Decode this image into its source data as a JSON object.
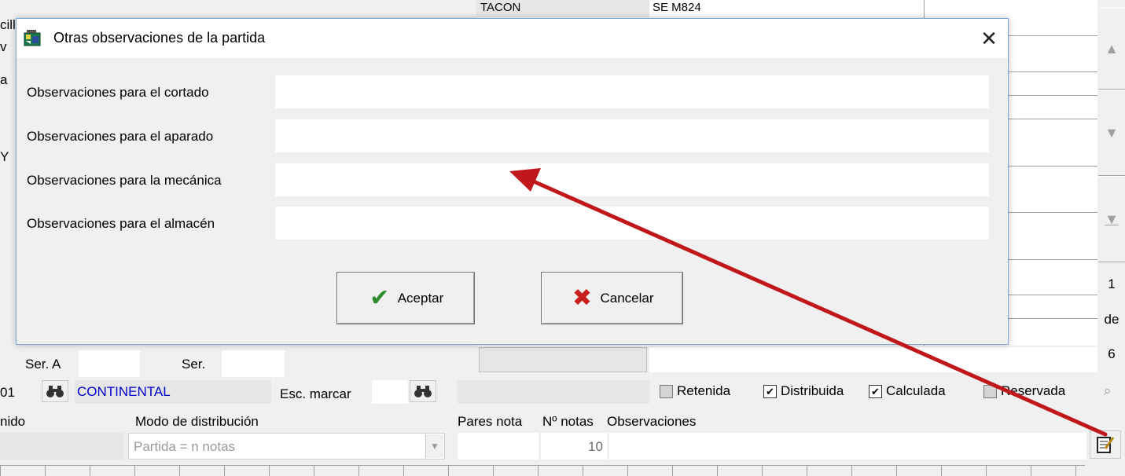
{
  "background": {
    "left_snippets": [
      "cill",
      "v",
      "a",
      "Y"
    ],
    "top_table": {
      "col1": "TACON",
      "col2": "SE M824"
    },
    "ser_a_label": "Ser. A",
    "ser_label": "Ser.",
    "row_prefix": "01",
    "client_name": "CONTINENTAL",
    "esc_marcar_label": "Esc. marcar",
    "checkboxes": [
      {
        "label": "Retenida",
        "checked": false
      },
      {
        "label": "Distribuida",
        "checked": true
      },
      {
        "label": "Calculada",
        "checked": true
      },
      {
        "label": "Reservada",
        "checked": false
      }
    ],
    "headers": {
      "contenido": "nido",
      "modo": "Modo de distribución",
      "pares": "Pares nota",
      "notas": "Nº notas",
      "observaciones": "Observaciones"
    },
    "modo_value": "Partida = n notas",
    "notas_value": "10",
    "pager": {
      "current": "1",
      "of": "de",
      "total": "6"
    }
  },
  "dialog": {
    "title": "Otras observaciones de la partida",
    "close_glyph": "✕",
    "fields": [
      {
        "label": "Observaciones para el cortado",
        "value": ""
      },
      {
        "label": "Observaciones para el aparado",
        "value": ""
      },
      {
        "label": "Observaciones para la mecánica",
        "value": ""
      },
      {
        "label": "Observaciones para el almacén",
        "value": ""
      }
    ],
    "accept_label": "Aceptar",
    "cancel_label": "Cancelar",
    "accept_icon": "✔",
    "cancel_icon": "✖"
  },
  "colors": {
    "accept": "#2e8b2e",
    "cancel": "#c81e1e",
    "arrow": "#c0171b",
    "link_text": "#0000cc",
    "dialog_border": "#7aa7d6"
  }
}
